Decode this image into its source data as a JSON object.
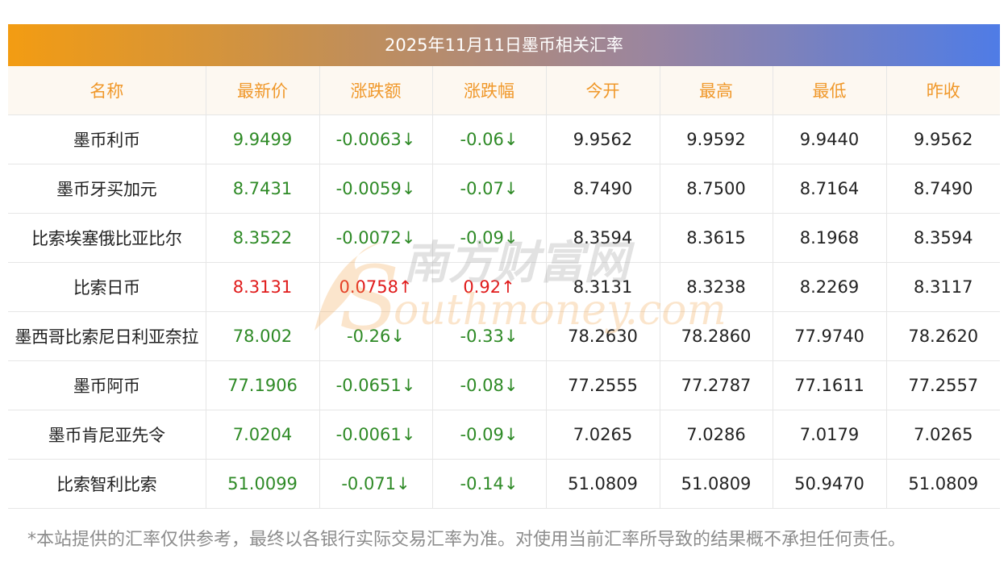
{
  "title": "2025年11月11日墨币相关汇率",
  "columns": [
    "名称",
    "最新价",
    "涨跌额",
    "涨跌幅",
    "今开",
    "最高",
    "最低",
    "昨收"
  ],
  "rows": [
    {
      "name": "墨币利币",
      "latest": "9.9499",
      "change": "-0.0063↓",
      "pct": "-0.06↓",
      "open": "9.9562",
      "high": "9.9592",
      "low": "9.9440",
      "prev": "9.9562",
      "dir": "down"
    },
    {
      "name": "墨币牙买加元",
      "latest": "8.7431",
      "change": "-0.0059↓",
      "pct": "-0.07↓",
      "open": "8.7490",
      "high": "8.7500",
      "low": "8.7164",
      "prev": "8.7490",
      "dir": "down"
    },
    {
      "name": "比索埃塞俄比亚比尔",
      "latest": "8.3522",
      "change": "-0.0072↓",
      "pct": "-0.09↓",
      "open": "8.3594",
      "high": "8.3615",
      "low": "8.1968",
      "prev": "8.3594",
      "dir": "down"
    },
    {
      "name": "比索日币",
      "latest": "8.3131",
      "change": "0.0758↑",
      "pct": "0.92↑",
      "open": "8.3131",
      "high": "8.3238",
      "low": "8.2269",
      "prev": "8.3117",
      "dir": "up"
    },
    {
      "name": "墨西哥比索尼日利亚奈拉",
      "latest": "78.002",
      "change": "-0.26↓",
      "pct": "-0.33↓",
      "open": "78.2630",
      "high": "78.2860",
      "low": "77.9740",
      "prev": "78.2620",
      "dir": "down"
    },
    {
      "name": "墨币阿币",
      "latest": "77.1906",
      "change": "-0.0651↓",
      "pct": "-0.08↓",
      "open": "77.2555",
      "high": "77.2787",
      "low": "77.1611",
      "prev": "77.2557",
      "dir": "down"
    },
    {
      "name": "墨币肯尼亚先令",
      "latest": "7.0204",
      "change": "-0.0061↓",
      "pct": "-0.09↓",
      "open": "7.0265",
      "high": "7.0286",
      "low": "7.0179",
      "prev": "7.0265",
      "dir": "down"
    },
    {
      "name": "比索智利比索",
      "latest": "51.0099",
      "change": "-0.071↓",
      "pct": "-0.14↓",
      "open": "51.0809",
      "high": "51.0809",
      "low": "50.9470",
      "prev": "51.0809",
      "dir": "down"
    }
  ],
  "watermark": {
    "cn": "南方财富网",
    "en": "outhmoney.com",
    "s": "S"
  },
  "footnote": "*本站提供的汇率仅供参考，最终以各银行实际交易汇率为准。对使用当前汇率所导致的结果概不承担任何责任。",
  "colors": {
    "up": "#e01b1b",
    "down": "#2e8a26",
    "header_text": "#f0982a",
    "header_bg": "#fdf8f1",
    "title_gradient_start": "#f39c12",
    "title_gradient_end": "#4f7ce6"
  }
}
